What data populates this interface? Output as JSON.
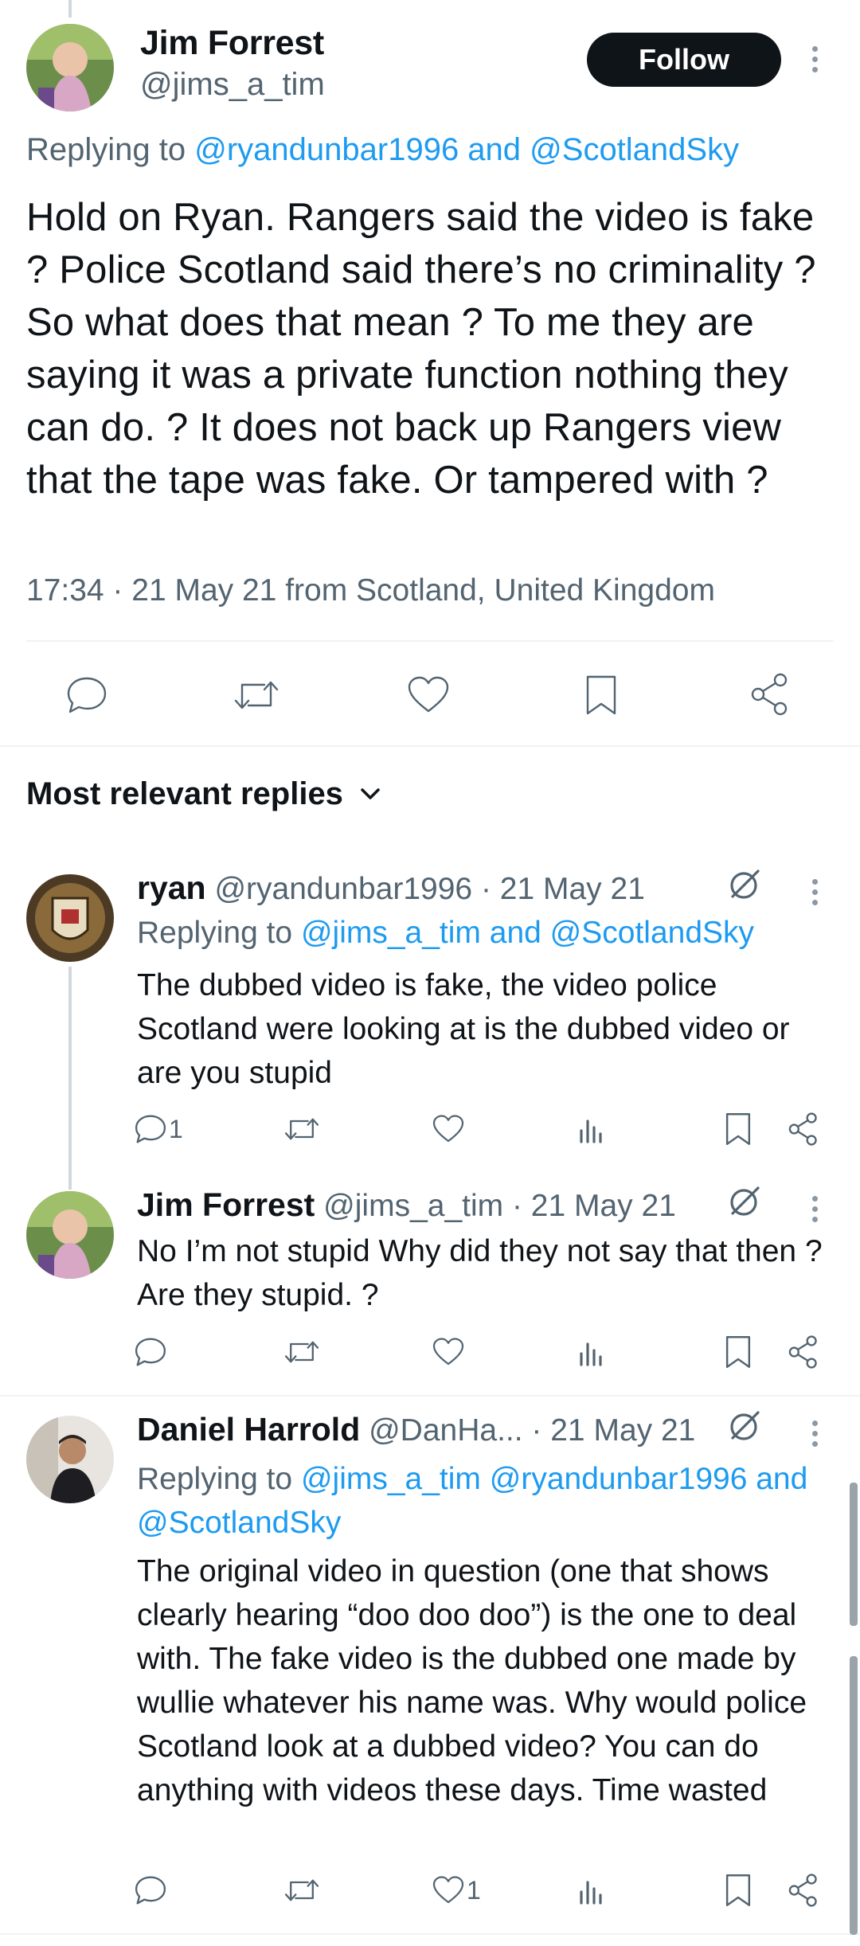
{
  "main": {
    "name": "Jim Forrest",
    "handle": "@jims_a_tim",
    "follow_label": "Follow",
    "replying_prefix": "Replying to ",
    "replying_to": "@ryandunbar1996 and @ScotlandSky",
    "text": "Hold on Ryan. Rangers said the video is fake ? Police Scotland said there’s no criminality ? So what does that mean ? To me they are saying it was a private function nothing they can do. ? It does not back up Rangers view that the tape was fake. Or tampered with ?",
    "meta": "17:34 · 21 May 21 from Scotland, United Kingdom"
  },
  "sort_label": "Most relevant replies",
  "replies": [
    {
      "name": "ryan",
      "handle": "@ryandunbar1996",
      "date": "· 21 May 21",
      "replying_prefix": "Replying to ",
      "replying_to": "@jims_a_tim and @ScotlandSky",
      "text": "The dubbed video is fake, the video police Scotland were looking at is the dubbed video or are you stupid",
      "reply_count": "1",
      "like_count": ""
    },
    {
      "name": "Jim Forrest",
      "handle": "@jims_a_tim",
      "date": "· 21 May 21",
      "text": "No I’m not stupid   Why did they not say that then ? Are they stupid. ?",
      "reply_count": "",
      "like_count": ""
    },
    {
      "name": "Daniel Harrold",
      "handle": "@DanHa...",
      "date": "· 21 May 21",
      "replying_prefix": "Replying to ",
      "replying_to": "@jims_a_tim @ryandunbar1996 and @ScotlandSky",
      "text": "The original video in question (one that shows clearly hearing “doo doo doo”) is the one to deal with. The fake video is the dubbed one made by wullie whatever his name was. Why would police Scotland look at a dubbed video? You can do anything with videos these days. Time wasted",
      "reply_count": "",
      "like_count": "1"
    }
  ],
  "icons": [
    "reply-icon",
    "retweet-icon",
    "like-icon",
    "views-icon",
    "bookmark-icon",
    "share-icon",
    "grok-icon",
    "more-icon",
    "chevron-down-icon"
  ],
  "colors": {
    "link": "#1d9bf0",
    "text": "#0f1419",
    "secondary": "#536471",
    "follow_bg": "#0f1419"
  }
}
